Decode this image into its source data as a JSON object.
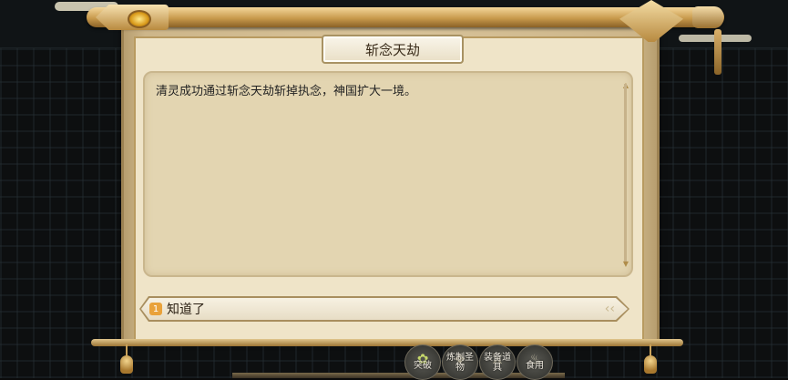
{
  "dialog": {
    "title": "斩念天劫",
    "message": "清灵成功通过斩念天劫斩掉执念，神国扩大一境。",
    "choice": {
      "number": "1",
      "label": "知道了"
    }
  },
  "bottom_menu": [
    {
      "label": "突破",
      "icon": "✿"
    },
    {
      "label": "炼制圣物",
      "icon": "❖"
    },
    {
      "label": "装备道具",
      "icon": "⚔"
    },
    {
      "label": "食用",
      "icon": "♨"
    }
  ],
  "colors": {
    "accent_orange": "#e9a23a",
    "paper": "#efe4c8",
    "gold": "#c89a4c"
  }
}
